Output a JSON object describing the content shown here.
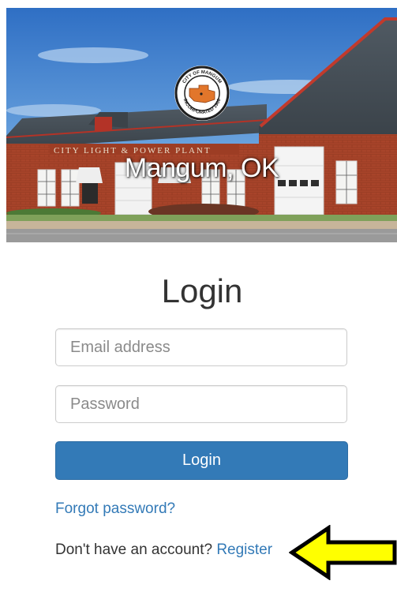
{
  "hero": {
    "title": "Mangum, OK",
    "building_sign": "CITY LIGHT & POWER PLANT",
    "seal": {
      "top_text": "CITY OF MANGUM",
      "bottom_text": "INCORPORATED 1900",
      "colors": {
        "ring": "#1f1f1f",
        "state": "#e2762b"
      }
    }
  },
  "login": {
    "title": "Login",
    "email": {
      "placeholder": "Email address",
      "value": ""
    },
    "password": {
      "placeholder": "Password",
      "value": ""
    },
    "submit_label": "Login",
    "forgot_label": "Forgot password?",
    "register_prompt": "Don't have an account?",
    "register_label": "Register"
  },
  "annotation": {
    "icon": "arrow-left-icon",
    "color": "#ffff00"
  },
  "colors": {
    "primary": "#337ab7",
    "primary_border": "#2e6da4",
    "text": "#333333",
    "input_border": "#cccccc"
  }
}
